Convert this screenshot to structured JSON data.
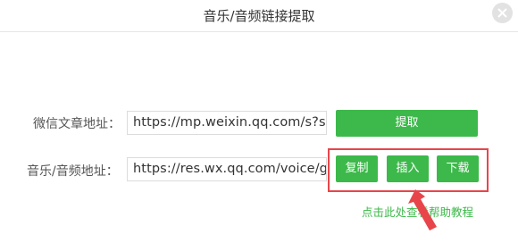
{
  "dialog": {
    "title": "音乐/音频链接提取"
  },
  "form": {
    "wechat_label": "微信文章地址：",
    "wechat_value": "https://mp.weixin.qq.com/s?sn",
    "extract_button": "提取",
    "audio_label": "音乐/音频地址：",
    "audio_value": "https://res.wx.qq.com/voice/g",
    "copy_button": "复制",
    "insert_button": "插入",
    "download_button": "下载"
  },
  "help_text": "点击此处查看帮助教程",
  "colors": {
    "accent_green": "#3cb94a",
    "highlight_red": "#e8454a"
  },
  "icons": [
    "close-icon",
    "arrow-pointer-icon"
  ]
}
